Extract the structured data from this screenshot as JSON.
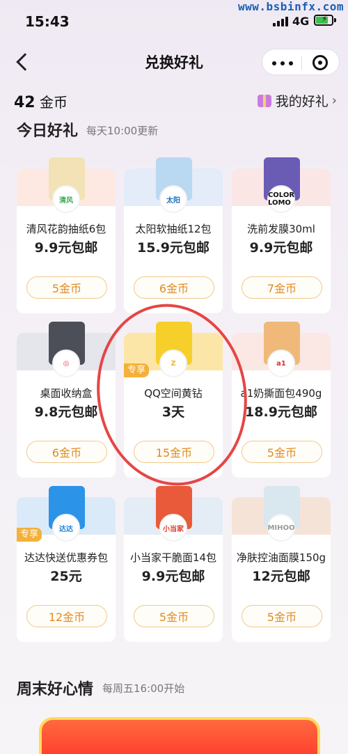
{
  "status_bar": {
    "time": "15:43",
    "network": "4G",
    "watermark": "www.bsbinfx.com"
  },
  "nav": {
    "title": "兑换好礼"
  },
  "coins": {
    "amount": "42",
    "unit": "金币",
    "my_gifts_label": "我的好礼"
  },
  "today": {
    "title": "今日好礼",
    "subtitle": "每天10:00更新",
    "items": [
      {
        "name": "清风花韵抽纸6包",
        "price": "9.9元包邮",
        "cost": "5金币",
        "badge": "",
        "top_color": "#fde9e2",
        "img_color": "#f2e2b5",
        "logo": "清风",
        "logo_color": "#3aa857"
      },
      {
        "name": "太阳软抽纸12包",
        "price": "15.9元包邮",
        "cost": "6金币",
        "badge": "",
        "top_color": "#e3ecf8",
        "img_color": "#b9d8f2",
        "logo": "太阳",
        "logo_color": "#1e6fb8"
      },
      {
        "name": "洗前发膜30ml",
        "price": "9.9元包邮",
        "cost": "7金币",
        "badge": "",
        "top_color": "#fbe6e6",
        "img_color": "#6a5bb5",
        "logo": "COLOR LOMO",
        "logo_color": "#111111"
      },
      {
        "name": "桌面收纳盒",
        "price": "9.8元包邮",
        "cost": "6金币",
        "badge": "",
        "top_color": "#e4e6ec",
        "img_color": "#4c4f57",
        "logo": "◎",
        "logo_color": "#e8425a"
      },
      {
        "name": "QQ空间黄钻",
        "price": "3天",
        "cost": "15金币",
        "badge": "专享",
        "top_color": "#fbe6a8",
        "img_color": "#f7cf2a",
        "logo": "Z",
        "logo_color": "#f4b51f"
      },
      {
        "name": "a1奶撕面包490g",
        "price": "18.9元包邮",
        "cost": "5金币",
        "badge": "",
        "top_color": "#fbe8e4",
        "img_color": "#f0b97a",
        "logo": "a1",
        "logo_color": "#e02c2c"
      },
      {
        "name": "达达快送优惠券包",
        "price": "25元",
        "cost": "12金币",
        "badge": "专享",
        "top_color": "#dbeaf8",
        "img_color": "#2b93e8",
        "logo": "达达",
        "logo_color": "#1b7fe0"
      },
      {
        "name": "小当家干脆面14包",
        "price": "9.9元包邮",
        "cost": "5金币",
        "badge": "",
        "top_color": "#e4ecf5",
        "img_color": "#e85a3a",
        "logo": "小当家",
        "logo_color": "#e03a2a"
      },
      {
        "name": "净肤控油面膜150g",
        "price": "12元包邮",
        "cost": "5金币",
        "badge": "",
        "top_color": "#f6e3d8",
        "img_color": "#d9e7ef",
        "logo": "MIHOO",
        "logo_color": "#999999"
      }
    ]
  },
  "weekend": {
    "title": "周末好心情",
    "subtitle": "每周五16:00开始"
  }
}
